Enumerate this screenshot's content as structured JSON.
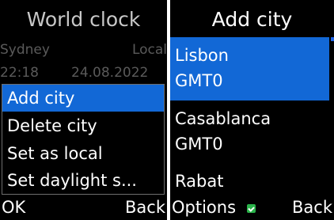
{
  "left": {
    "title": "World clock",
    "city": "Sydney",
    "local": "Local",
    "time": "22:18",
    "date": "24.08.2022",
    "menu": [
      "Add city",
      "Delete city",
      "Set as local",
      "Set daylight s..."
    ],
    "soft_left": "OK",
    "soft_right": "Back"
  },
  "right": {
    "title": "Add city",
    "cities": [
      {
        "name": "Lisbon",
        "tz": "GMT0"
      },
      {
        "name": "Casablanca",
        "tz": "GMT0"
      },
      {
        "name": "Rabat",
        "tz": ""
      }
    ],
    "soft_left": "Options",
    "soft_right": "Back"
  },
  "colors": {
    "accent": "#1268d6",
    "status": "#2ab34a"
  }
}
